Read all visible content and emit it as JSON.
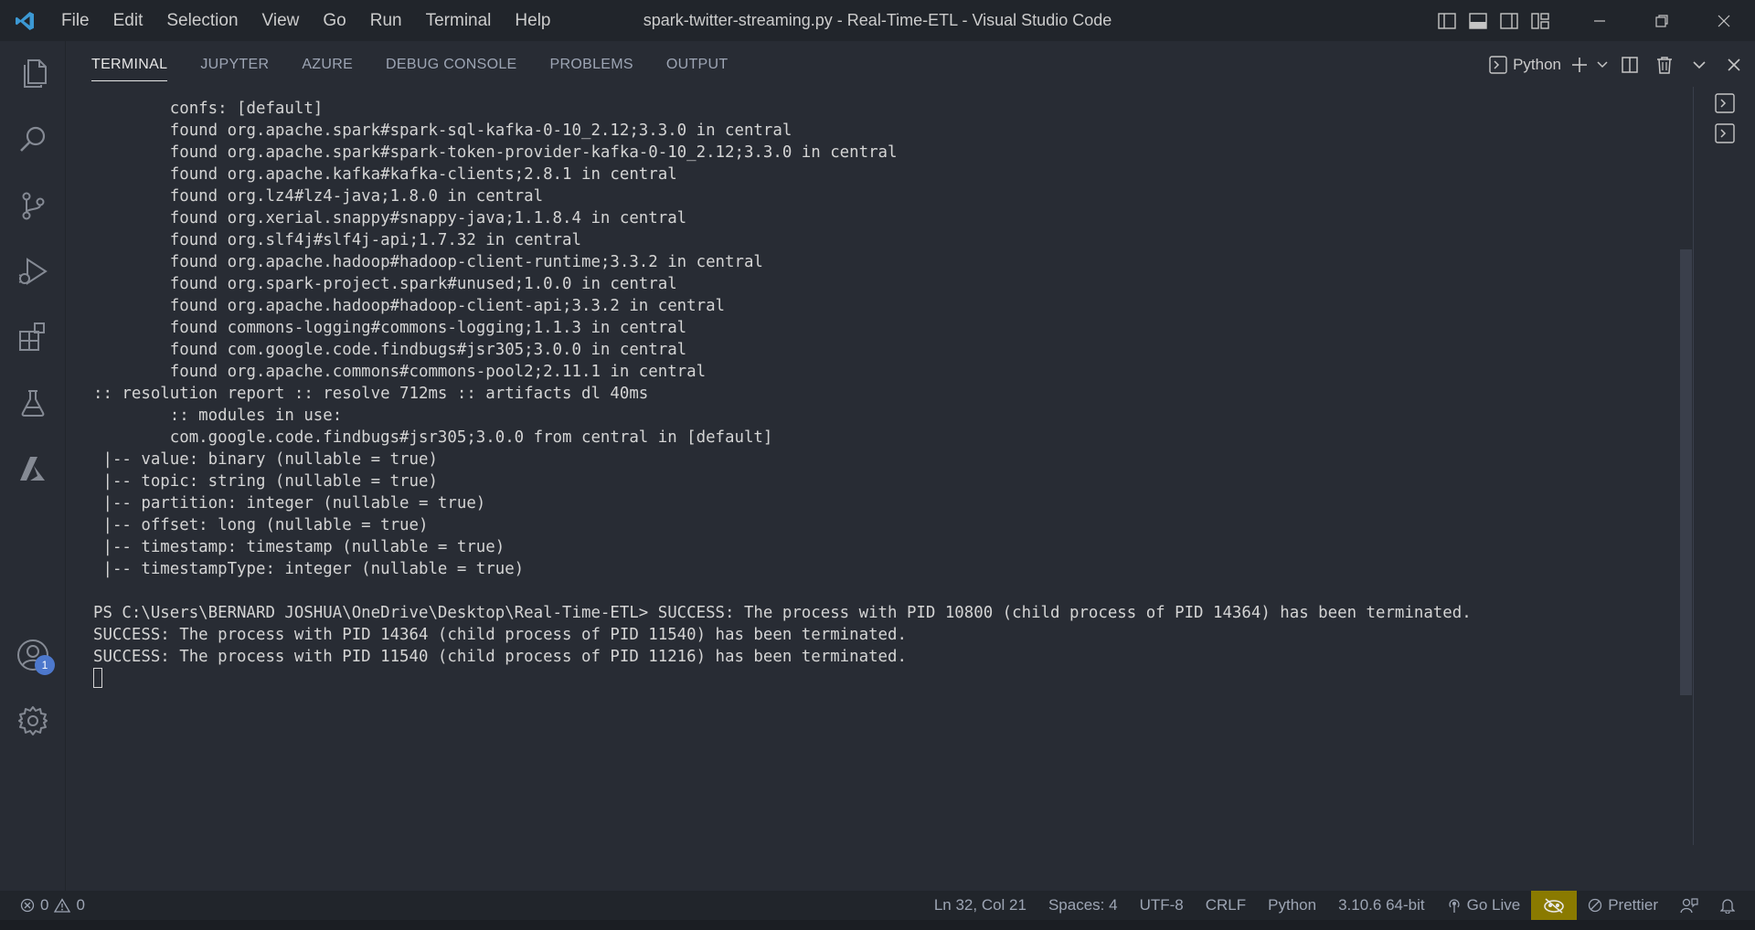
{
  "window": {
    "title": "spark-twitter-streaming.py - Real-Time-ETL - Visual Studio Code"
  },
  "menu": [
    "File",
    "Edit",
    "Selection",
    "View",
    "Go",
    "Run",
    "Terminal",
    "Help"
  ],
  "activity_bar": {
    "items": [
      "explorer-icon",
      "search-icon",
      "source-control-icon",
      "run-debug-icon",
      "extensions-icon",
      "testing-icon",
      "azure-icon"
    ],
    "accounts_badge": "1"
  },
  "panel": {
    "tabs": [
      "TERMINAL",
      "JUPYTER",
      "AZURE",
      "DEBUG CONSOLE",
      "PROBLEMS",
      "OUTPUT"
    ],
    "active_tab": "TERMINAL",
    "shell": "Python"
  },
  "terminal": {
    "lines": [
      "        confs: [default]",
      "        found org.apache.spark#spark-sql-kafka-0-10_2.12;3.3.0 in central",
      "        found org.apache.spark#spark-token-provider-kafka-0-10_2.12;3.3.0 in central",
      "        found org.apache.kafka#kafka-clients;2.8.1 in central",
      "        found org.lz4#lz4-java;1.8.0 in central",
      "        found org.xerial.snappy#snappy-java;1.1.8.4 in central",
      "        found org.slf4j#slf4j-api;1.7.32 in central",
      "        found org.apache.hadoop#hadoop-client-runtime;3.3.2 in central",
      "        found org.spark-project.spark#unused;1.0.0 in central",
      "        found org.apache.hadoop#hadoop-client-api;3.3.2 in central",
      "        found commons-logging#commons-logging;1.1.3 in central",
      "        found com.google.code.findbugs#jsr305;3.0.0 in central",
      "        found org.apache.commons#commons-pool2;2.11.1 in central",
      ":: resolution report :: resolve 712ms :: artifacts dl 40ms",
      "        :: modules in use:",
      "        com.google.code.findbugs#jsr305;3.0.0 from central in [default]",
      " |-- value: binary (nullable = true)",
      " |-- topic: string (nullable = true)",
      " |-- partition: integer (nullable = true)",
      " |-- offset: long (nullable = true)",
      " |-- timestamp: timestamp (nullable = true)",
      " |-- timestampType: integer (nullable = true)",
      "",
      "PS C:\\Users\\BERNARD JOSHUA\\OneDrive\\Desktop\\Real-Time-ETL> SUCCESS: The process with PID 10800 (child process of PID 14364) has been terminated.",
      "SUCCESS: The process with PID 14364 (child process of PID 11540) has been terminated.",
      "SUCCESS: The process with PID 11540 (child process of PID 11216) has been terminated."
    ]
  },
  "status_bar": {
    "errors": "0",
    "warnings": "0",
    "position": "Ln 32, Col 21",
    "spaces": "Spaces: 4",
    "encoding": "UTF-8",
    "eol": "CRLF",
    "language": "Python",
    "interpreter": "3.10.6 64-bit",
    "go_live": "Go Live",
    "prettier": "Prettier"
  },
  "colors": {
    "background": "#282c34",
    "titlebar": "#21252b",
    "badge": "#4d78cc",
    "highlight": "#8a7a00"
  }
}
